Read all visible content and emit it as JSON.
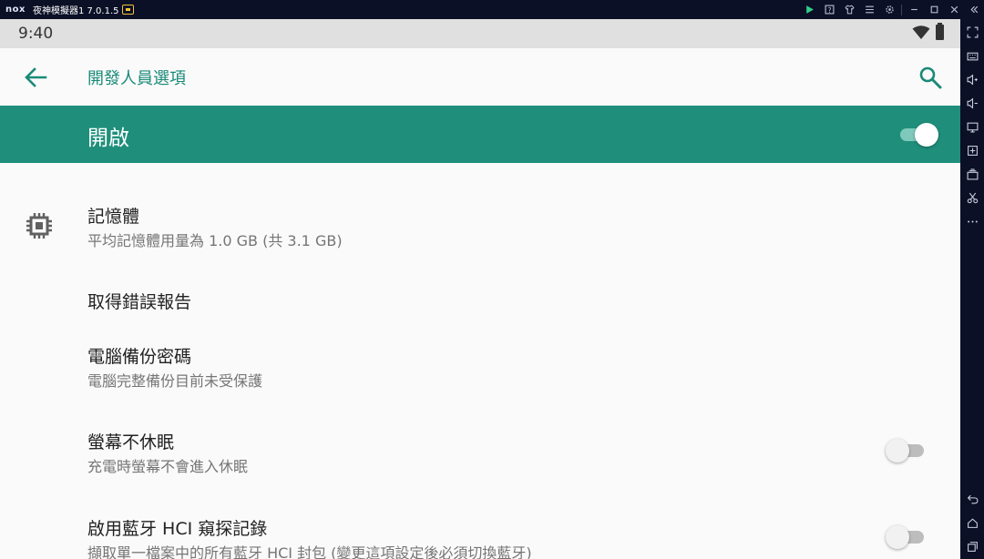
{
  "window": {
    "logo": "nox",
    "title": "夜神模擬器1 7.0.1.5",
    "controls": [
      "play-icon",
      "help-icon",
      "shirt-icon",
      "menu-icon",
      "settings-icon",
      "minimize-icon",
      "maximize-icon",
      "close-icon",
      "collapse-icon"
    ]
  },
  "statusbar": {
    "time": "9:40"
  },
  "appbar": {
    "title": "開發人員選項"
  },
  "master": {
    "label": "開啟",
    "enabled": true
  },
  "items": [
    {
      "title": "記憶體",
      "subtitle": "平均記憶體用量為 1.0 GB (共 3.1 GB)",
      "icon": "memory-chip-icon"
    },
    {
      "title": "取得錯誤報告",
      "subtitle": ""
    },
    {
      "title": "電腦備份密碼",
      "subtitle": "電腦完整備份目前未受保護"
    },
    {
      "title": "螢幕不休眠",
      "subtitle": "充電時螢幕不會進入休眠",
      "toggle": false
    },
    {
      "title": "啟用藍牙 HCI 窺探記錄",
      "subtitle": "擷取單一檔案中的所有藍牙 HCI 封包 (變更這項設定後必須切換藍牙)",
      "toggle": false
    }
  ],
  "colors": {
    "accent": "#1f8f7c",
    "accent_text": "#1a8a78",
    "background": "#fafafa",
    "statusbar": "#e0e0e0",
    "emulator_chrome": "#0b1026"
  }
}
